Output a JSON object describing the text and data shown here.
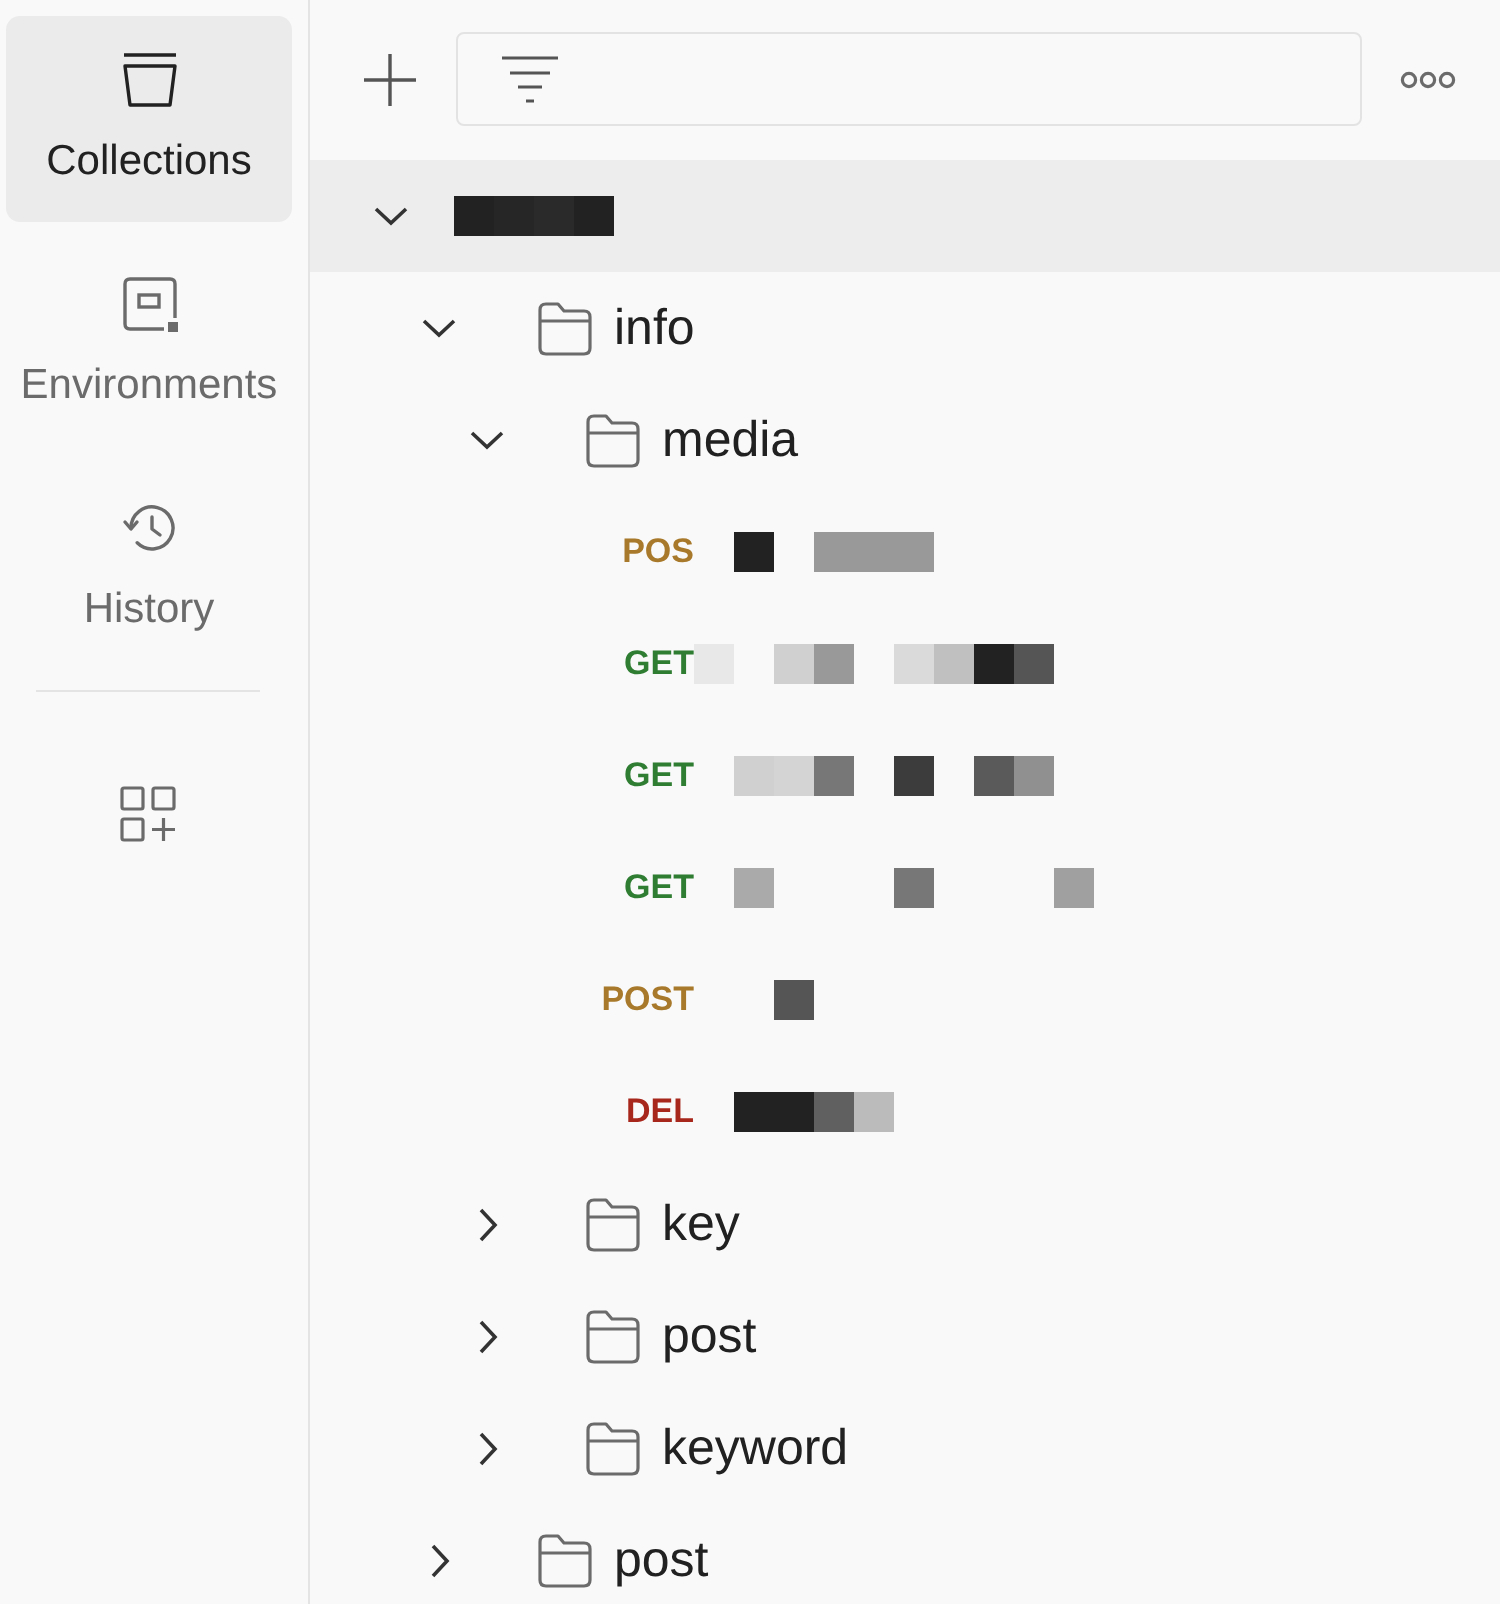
{
  "sidebar": {
    "items": [
      {
        "kind": "collections",
        "label": "Collections",
        "selected": true
      },
      {
        "kind": "environments",
        "label": "Environments",
        "selected": false
      },
      {
        "kind": "history",
        "label": "History",
        "selected": false
      }
    ]
  },
  "collection": {
    "expanded": true,
    "selected": true,
    "children": [
      {
        "kind": "folder",
        "name": "info",
        "expanded": true,
        "selected": false,
        "children": [
          {
            "kind": "folder",
            "name": "media",
            "expanded": true,
            "selected": false,
            "children": [
              {
                "kind": "request",
                "method": "POS",
                "color": "#a8792a",
                "selected": false
              },
              {
                "kind": "request",
                "method": "GET",
                "color": "#2e7d32",
                "selected": false
              },
              {
                "kind": "request",
                "method": "GET",
                "color": "#2e7d32",
                "selected": false
              },
              {
                "kind": "request",
                "method": "GET",
                "color": "#2e7d32",
                "selected": false
              },
              {
                "kind": "request",
                "method": "POST",
                "color": "#a8792a",
                "selected": false
              },
              {
                "kind": "request",
                "method": "DEL",
                "color": "#a8271c",
                "selected": false
              }
            ]
          },
          {
            "kind": "folder",
            "name": "key",
            "expanded": false,
            "selected": false
          },
          {
            "kind": "folder",
            "name": "post",
            "expanded": false,
            "selected": false
          },
          {
            "kind": "folder",
            "name": "keyword",
            "expanded": false,
            "selected": false
          }
        ]
      },
      {
        "kind": "folder",
        "name": "post",
        "expanded": false,
        "selected": false
      }
    ]
  }
}
